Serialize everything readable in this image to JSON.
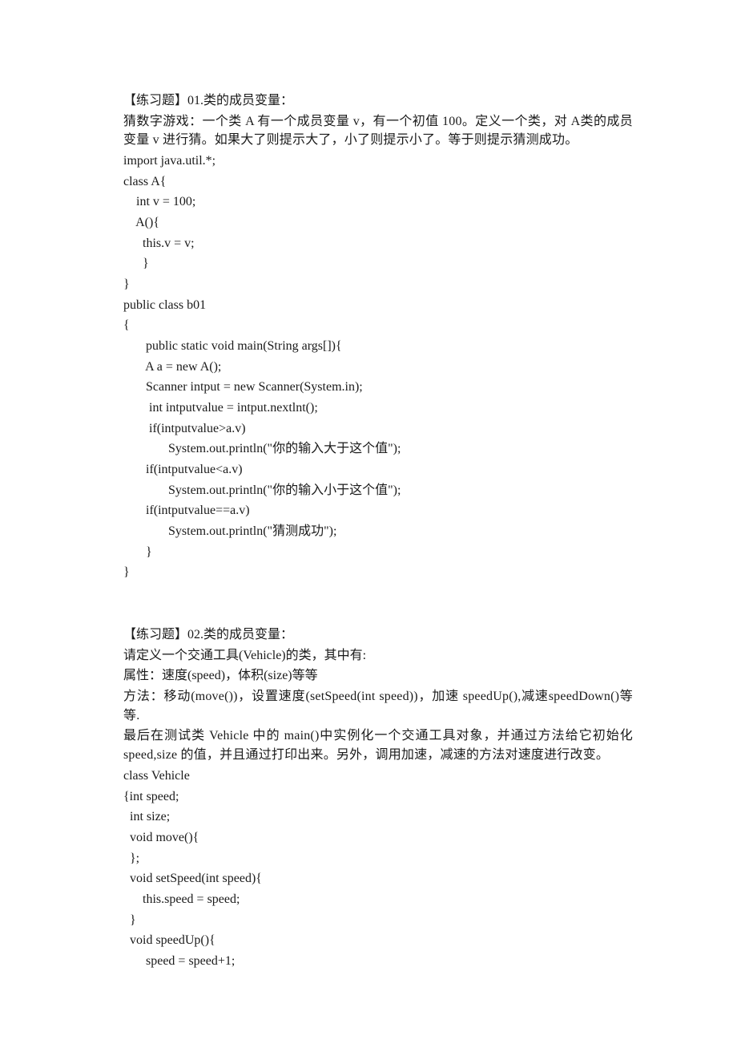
{
  "lines": [
    "【练习题】01.类的成员变量：",
    "猜数字游戏：一个类 A 有一个成员变量 v，有一个初值 100。定义一个类，对 A类的成员变量 v 进行猜。如果大了则提示大了，小了则提示小了。等于则提示猜测成功。",
    "import java.util.*;",
    "class A{",
    "    int v = 100;",
    "    A(){",
    "      this.v = v;",
    "      }",
    "}",
    "public class b01",
    "{",
    "       public static void main(String args[]){",
    "       A a = new A();",
    "       Scanner intput = new Scanner(System.in);",
    "        int intputvalue = intput.nextlnt();",
    "        if(intputvalue>a.v)",
    "              System.out.println(\"你的输入大于这个值\");",
    "       if(intputvalue<a.v)",
    "              System.out.println(\"你的输入小于这个值\");",
    "       if(intputvalue==a.v)",
    "              System.out.println(\"猜测成功\");",
    "       }",
    "}",
    "",
    "【练习题】02.类的成员变量：",
    "请定义一个交通工具(Vehicle)的类，其中有:",
    "属性：速度(speed)，体积(size)等等",
    "方法：移动(move())，设置速度(setSpeed(int speed))，加速 speedUp(),减速speedDown()等等.",
    "最后在测试类 Vehicle 中的 main()中实例化一个交通工具对象，并通过方法给它初始化 speed,size 的值，并且通过打印出来。另外，调用加速，减速的方法对速度进行改变。",
    "class Vehicle",
    "{int speed;",
    "  int size;",
    "  void move(){",
    "  };",
    "  void setSpeed(int speed){",
    "      this.speed = speed;",
    "  }",
    "  void speedUp(){",
    "       speed = speed+1;"
  ],
  "justify_indices": [
    1,
    27,
    28
  ]
}
